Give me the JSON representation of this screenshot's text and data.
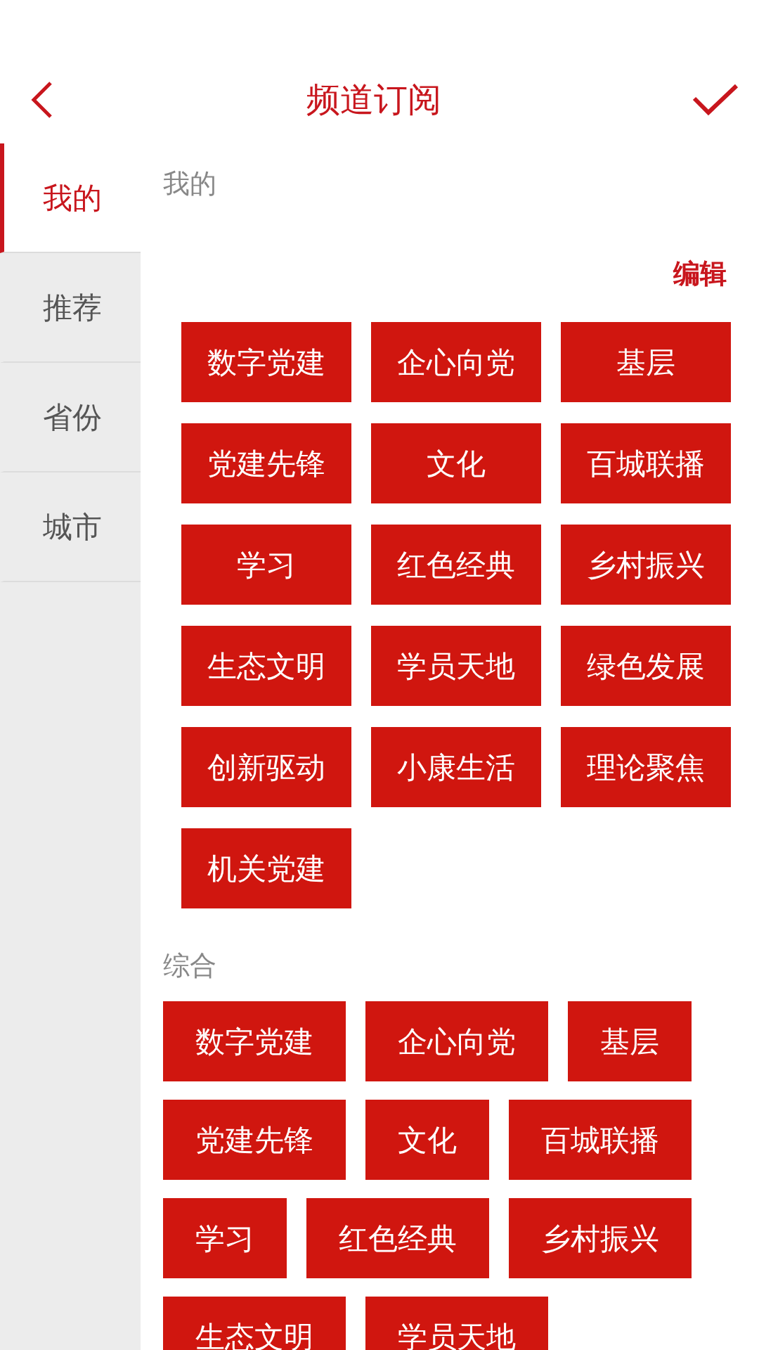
{
  "header": {
    "title": "频道订阅"
  },
  "sidebar": {
    "items": [
      {
        "label": "我的",
        "selected": true
      },
      {
        "label": "推荐",
        "selected": false
      },
      {
        "label": "省份",
        "selected": false
      },
      {
        "label": "城市",
        "selected": false
      }
    ]
  },
  "my_section": {
    "title": "我的",
    "edit": "编辑",
    "channels": [
      "数字党建",
      "企心向党",
      "基层",
      "党建先锋",
      "文化",
      "百城联播",
      "学习",
      "红色经典",
      "乡村振兴",
      "生态文明",
      "学员天地",
      "绿色发展",
      "创新驱动",
      "小康生活",
      "理论聚焦",
      "机关党建"
    ]
  },
  "general_section": {
    "title": "综合",
    "channels": [
      "数字党建",
      "企心向党",
      "基层",
      "党建先锋",
      "文化",
      "百城联播",
      "学习",
      "红色经典",
      "乡村振兴",
      "生态文明",
      "学员天地"
    ]
  }
}
